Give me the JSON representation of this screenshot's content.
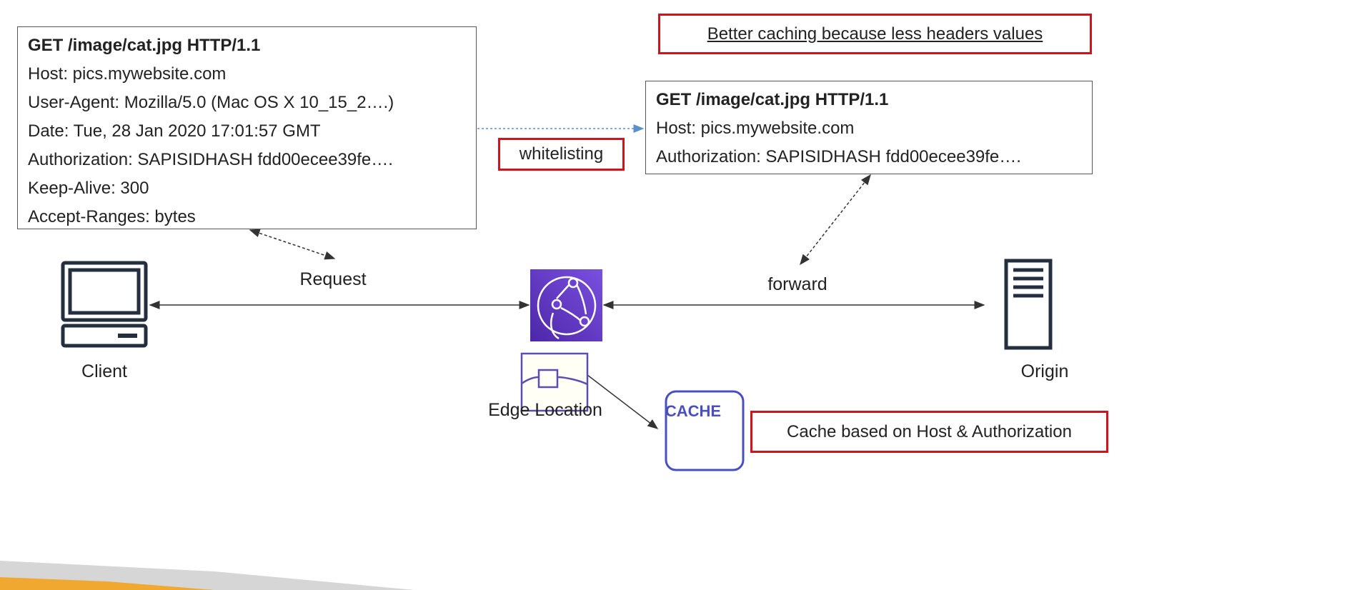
{
  "client_request": {
    "lines": [
      "GET /image/cat.jpg   HTTP/1.1",
      "Host: pics.mywebsite.com",
      "User-Agent: Mozilla/5.0 (Mac OS X 10_15_2….)",
      "Date: Tue, 28 Jan 2020 17:01:57 GMT",
      "Authorization: SAPISIDHASH fdd00ecee39fe….",
      "Keep-Alive: 300",
      "Accept-Ranges: bytes"
    ]
  },
  "forwarded_request": {
    "lines": [
      "GET /image/cat.jpg   HTTP/1.1",
      "Host: pics.mywebsite.com",
      "Authorization: SAPISIDHASH fdd00ecee39fe…."
    ]
  },
  "notes": {
    "better_caching": "Better caching because less headers values",
    "whitelisting": "whitelisting",
    "cache_based_on": "Cache based on Host & Authorization"
  },
  "labels": {
    "request": "Request",
    "forward": "forward",
    "client": "Client",
    "origin": "Origin",
    "edge_location": "Edge Location",
    "cache": "CACHE"
  },
  "colors": {
    "highlight_border": "#d0131d",
    "cloudfront_purple": "#6b3fd4",
    "cache_blue": "#4a4fc0",
    "accent_orange": "#f0a830"
  },
  "icons": [
    "client-computer-icon",
    "cloudfront-icon",
    "edge-location-icon",
    "cache-icon",
    "origin-server-icon"
  ]
}
